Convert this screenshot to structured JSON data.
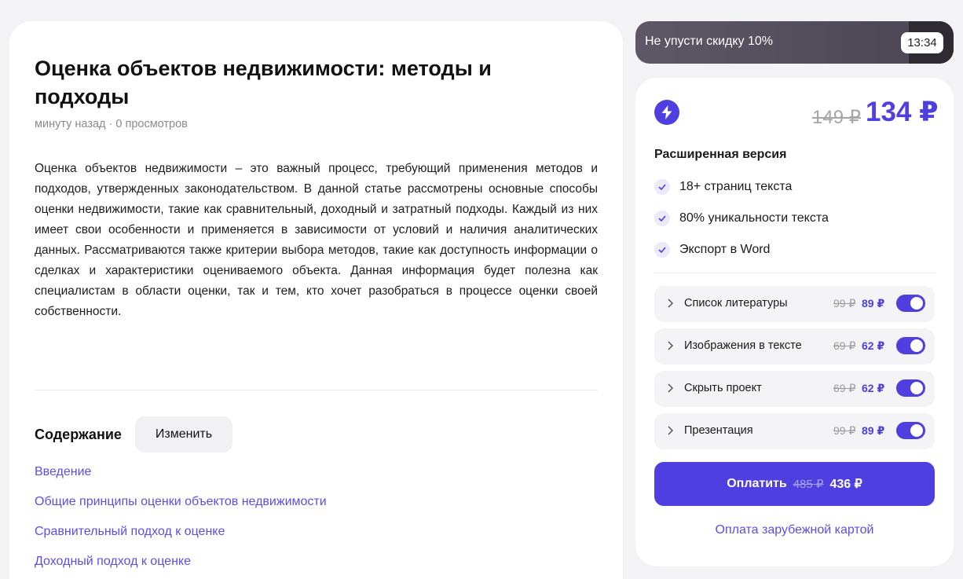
{
  "article": {
    "title": "Оценка объектов недвижимости: методы и подходы",
    "meta": "минуту назад · 0 просмотров",
    "body": "Оценка объектов недвижимости – это важный процесс, требующий применения методов и подходов, утвержденных законодательством. В данной статье рассмотрены основные способы оценки недвижимости, такие как сравнительный, доходный и затратный подходы. Каждый из них имеет свои особенности и применяется в зависимости от условий и наличия аналитических данных. Рассматриваются также критерии выбора методов, такие как доступность информации о сделках и характеристики оцениваемого объекта. Данная информация будет полезна как специалистам в области оценки, так и тем, кто хочет разобраться в процессе оценки своей собственности."
  },
  "toc": {
    "heading": "Содержание",
    "edit_label": "Изменить",
    "items": [
      "Введение",
      "Общие принципы оценки объектов недвижимости",
      "Сравнительный подход к оценке",
      "Доходный подход к оценке"
    ]
  },
  "promo": {
    "text": "Не упусти скидку 10%",
    "timer": "13:34"
  },
  "offer": {
    "icon": "lightning-icon",
    "old_price": "149 ₽",
    "new_price": "134 ₽",
    "version": "Расширенная версия",
    "features": [
      "18+ страниц текста",
      "80% уникальности текста",
      "Экспорт в Word"
    ],
    "addons": [
      {
        "name": "Список литературы",
        "old": "99 ₽",
        "new": "89 ₽",
        "enabled": true
      },
      {
        "name": "Изображения в тексте",
        "old": "69 ₽",
        "new": "62 ₽",
        "enabled": true
      },
      {
        "name": "Скрыть проект",
        "old": "69 ₽",
        "new": "62 ₽",
        "enabled": true
      },
      {
        "name": "Презентация",
        "old": "99 ₽",
        "new": "89 ₽",
        "enabled": true
      }
    ],
    "pay": {
      "label": "Оплатить",
      "old": "485 ₽",
      "new": "436 ₽"
    },
    "foreign_card": "Оплата зарубежной картой"
  },
  "colors": {
    "accent": "#4f3fe0",
    "link": "#5b4ee6",
    "background": "#f3f3f5",
    "promo_bg": "#55505e"
  }
}
